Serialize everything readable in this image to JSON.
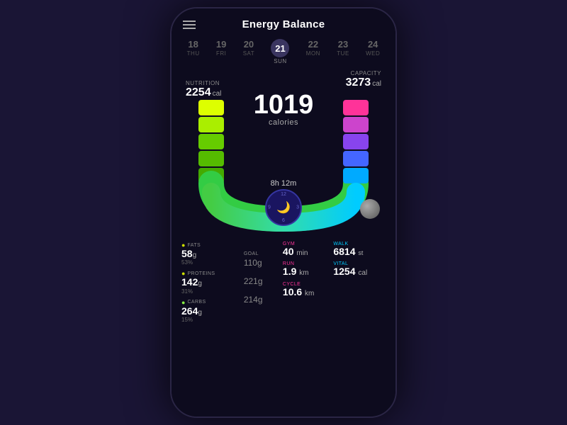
{
  "app": {
    "title": "Energy Balance"
  },
  "header": {
    "menu_label": "menu"
  },
  "dates": [
    {
      "num": "18",
      "day": "THU",
      "active": false
    },
    {
      "num": "19",
      "day": "FRI",
      "active": false
    },
    {
      "num": "20",
      "day": "SAT",
      "active": false
    },
    {
      "num": "21",
      "day": "SUN",
      "active": true
    },
    {
      "num": "22",
      "day": "MON",
      "active": false
    },
    {
      "num": "23",
      "day": "TUE",
      "active": false
    },
    {
      "num": "24",
      "day": "WED",
      "active": false
    }
  ],
  "capacity": {
    "label": "CAPACITY",
    "value": "3273",
    "unit": "cal"
  },
  "nutrition": {
    "label": "NUTRITION",
    "value": "2254",
    "unit": "cal"
  },
  "calories": {
    "number": "1019",
    "label": "calories"
  },
  "sleep": {
    "time": "8h 12m",
    "numbers": [
      "12",
      "3",
      "6",
      "9"
    ]
  },
  "stats": {
    "fats": {
      "label": "FATS",
      "value": "58",
      "unit": "g",
      "sub": "53%",
      "icon": "🌙"
    },
    "goal": {
      "label": "GOAL",
      "value": "110",
      "unit": "g"
    },
    "gym": {
      "label": "GYM",
      "value": "40",
      "unit": "min"
    },
    "walk": {
      "label": "WALK",
      "value": "6814",
      "unit": "st"
    },
    "proteins": {
      "label": "PROTEINS",
      "value": "142",
      "unit": "g",
      "sub": "31%",
      "goal": "221g",
      "icon": "🌙"
    },
    "run": {
      "label": "RUN",
      "value": "1.9",
      "unit": "km"
    },
    "vital": {
      "label": "VITAL",
      "value": "1254",
      "unit": "cal"
    },
    "carbs": {
      "label": "CARBS",
      "value": "264",
      "unit": "g",
      "sub": "15%",
      "goal": "214g",
      "icon": "🌿"
    },
    "cycle": {
      "label": "CYCLE",
      "value": "10.6",
      "unit": "km"
    }
  },
  "colors": {
    "background": "#0d0b1e",
    "accent_pink": "#ff3399",
    "accent_cyan": "#00ccff",
    "accent_yellow": "#ccff00",
    "accent_green": "#66ff00",
    "accent_purple": "#aa44ff",
    "accent_blue": "#4488ff"
  }
}
